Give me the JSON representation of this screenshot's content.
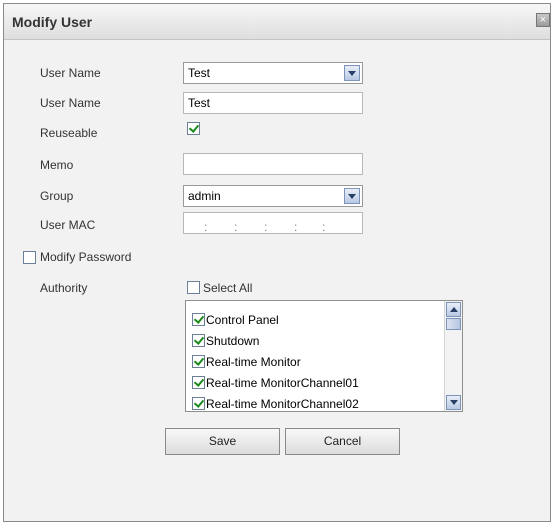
{
  "dialog": {
    "title": "Modify User",
    "close_glyph": "×"
  },
  "form": {
    "user_name_select": {
      "label": "User Name",
      "value": "Test"
    },
    "user_name_input": {
      "label": "User Name",
      "value": "Test"
    },
    "reuseable": {
      "label": "Reuseable",
      "checked": true
    },
    "memo": {
      "label": "Memo",
      "value": ""
    },
    "group": {
      "label": "Group",
      "value": "admin"
    },
    "user_mac": {
      "label": "User MAC",
      "separators": [
        ":",
        ":",
        ":",
        ":",
        ":"
      ]
    },
    "modify_password": {
      "label": "Modify Password",
      "checked": false
    },
    "authority": {
      "label": "Authority",
      "select_all_label": "Select All",
      "select_all_checked": false
    }
  },
  "authority_list": [
    {
      "label": "Control Panel",
      "checked": true
    },
    {
      "label": "Shutdown",
      "checked": true
    },
    {
      "label": "Real-time Monitor",
      "checked": true
    },
    {
      "label": "Real-time MonitorChannel01",
      "checked": true
    },
    {
      "label": "Real-time MonitorChannel02",
      "checked": true
    }
  ],
  "buttons": {
    "save": "Save",
    "cancel": "Cancel"
  }
}
